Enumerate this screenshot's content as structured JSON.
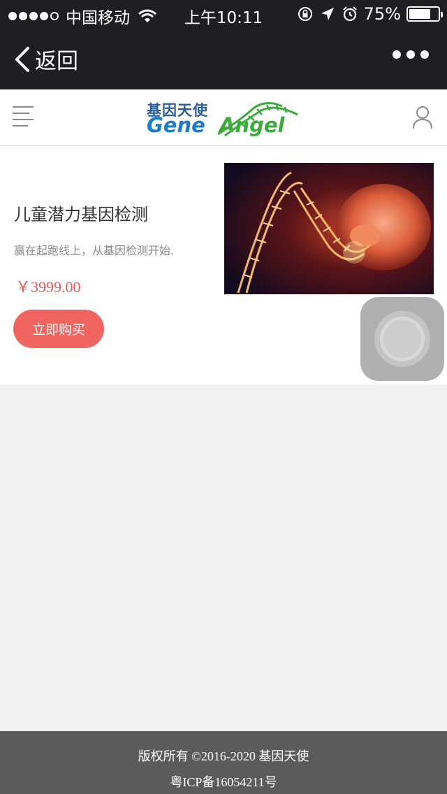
{
  "status_bar": {
    "carrier": "中国移动",
    "time": "上午10:11",
    "battery": "75%",
    "battery_level": 0.75,
    "icons": [
      "signal-dots-icon",
      "wifi-icon",
      "rotation-lock-icon",
      "location-icon",
      "alarm-icon",
      "battery-icon"
    ]
  },
  "nav": {
    "back_label": "返回",
    "icons": [
      "back-chevron-icon",
      "more-dots-icon"
    ]
  },
  "header": {
    "logo_cn": "基因天使",
    "logo_gene": "Gene",
    "logo_angel": "Angel",
    "icons": [
      "menu-icon",
      "user-icon"
    ],
    "colors": {
      "gene": "#1a7ccc",
      "angel": "#3cab3c"
    }
  },
  "product": {
    "title": "儿童潜力基因检测",
    "description": "赢在起跑线上，从基因检测开始.",
    "price": "￥3999.00",
    "buy_label": "立即购买",
    "image_icon": "dna-fetus-image",
    "colors": {
      "price": "#e85b55",
      "button": "#f06560"
    }
  },
  "footer": {
    "copyright": "版权所有 ©2016-2020 基因天使",
    "icp": "粤ICP备16054211号"
  }
}
